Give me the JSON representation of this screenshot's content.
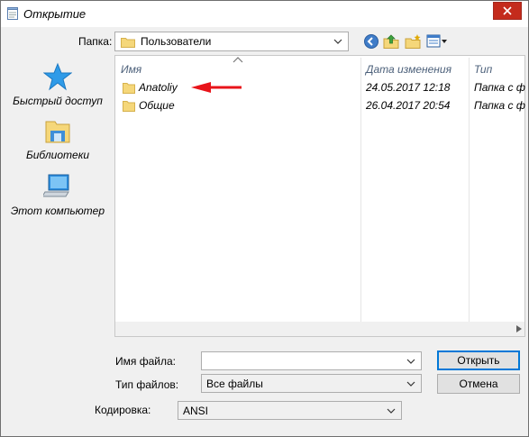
{
  "titlebar": {
    "title": "Открытие",
    "close_label": "✕"
  },
  "toolbar": {
    "folder_label": "Папка:",
    "folder_value": "Пользователи",
    "icons": [
      "back-icon",
      "up-folder-icon",
      "new-folder-icon",
      "view-menu-icon"
    ]
  },
  "places": [
    {
      "label": "Быстрый доступ",
      "icon": "quick-access-star-icon"
    },
    {
      "label": "Библиотеки",
      "icon": "libraries-icon"
    },
    {
      "label": "Этот компьютер",
      "icon": "computer-icon"
    }
  ],
  "filelist": {
    "columns": [
      "Имя",
      "Дата изменения",
      "Тип"
    ],
    "rows": [
      {
        "name": "Anatoliy",
        "date": "24.05.2017 12:18",
        "type": "Папка с ф"
      },
      {
        "name": "Общие",
        "date": "26.04.2017 20:54",
        "type": "Папка с ф"
      }
    ]
  },
  "bottom": {
    "filename_label": "Имя файла:",
    "filename_value": "",
    "filetype_label": "Тип файлов:",
    "filetype_value": "Все файлы",
    "encoding_label": "Кодировка:",
    "encoding_value": "ANSI",
    "open_button": "Открыть",
    "cancel_button": "Отмена"
  },
  "colors": {
    "accent": "#0078d7",
    "close_red": "#c42b1c",
    "annotation_arrow": "#e8141a",
    "folder_yellow": "#f5d77a"
  }
}
